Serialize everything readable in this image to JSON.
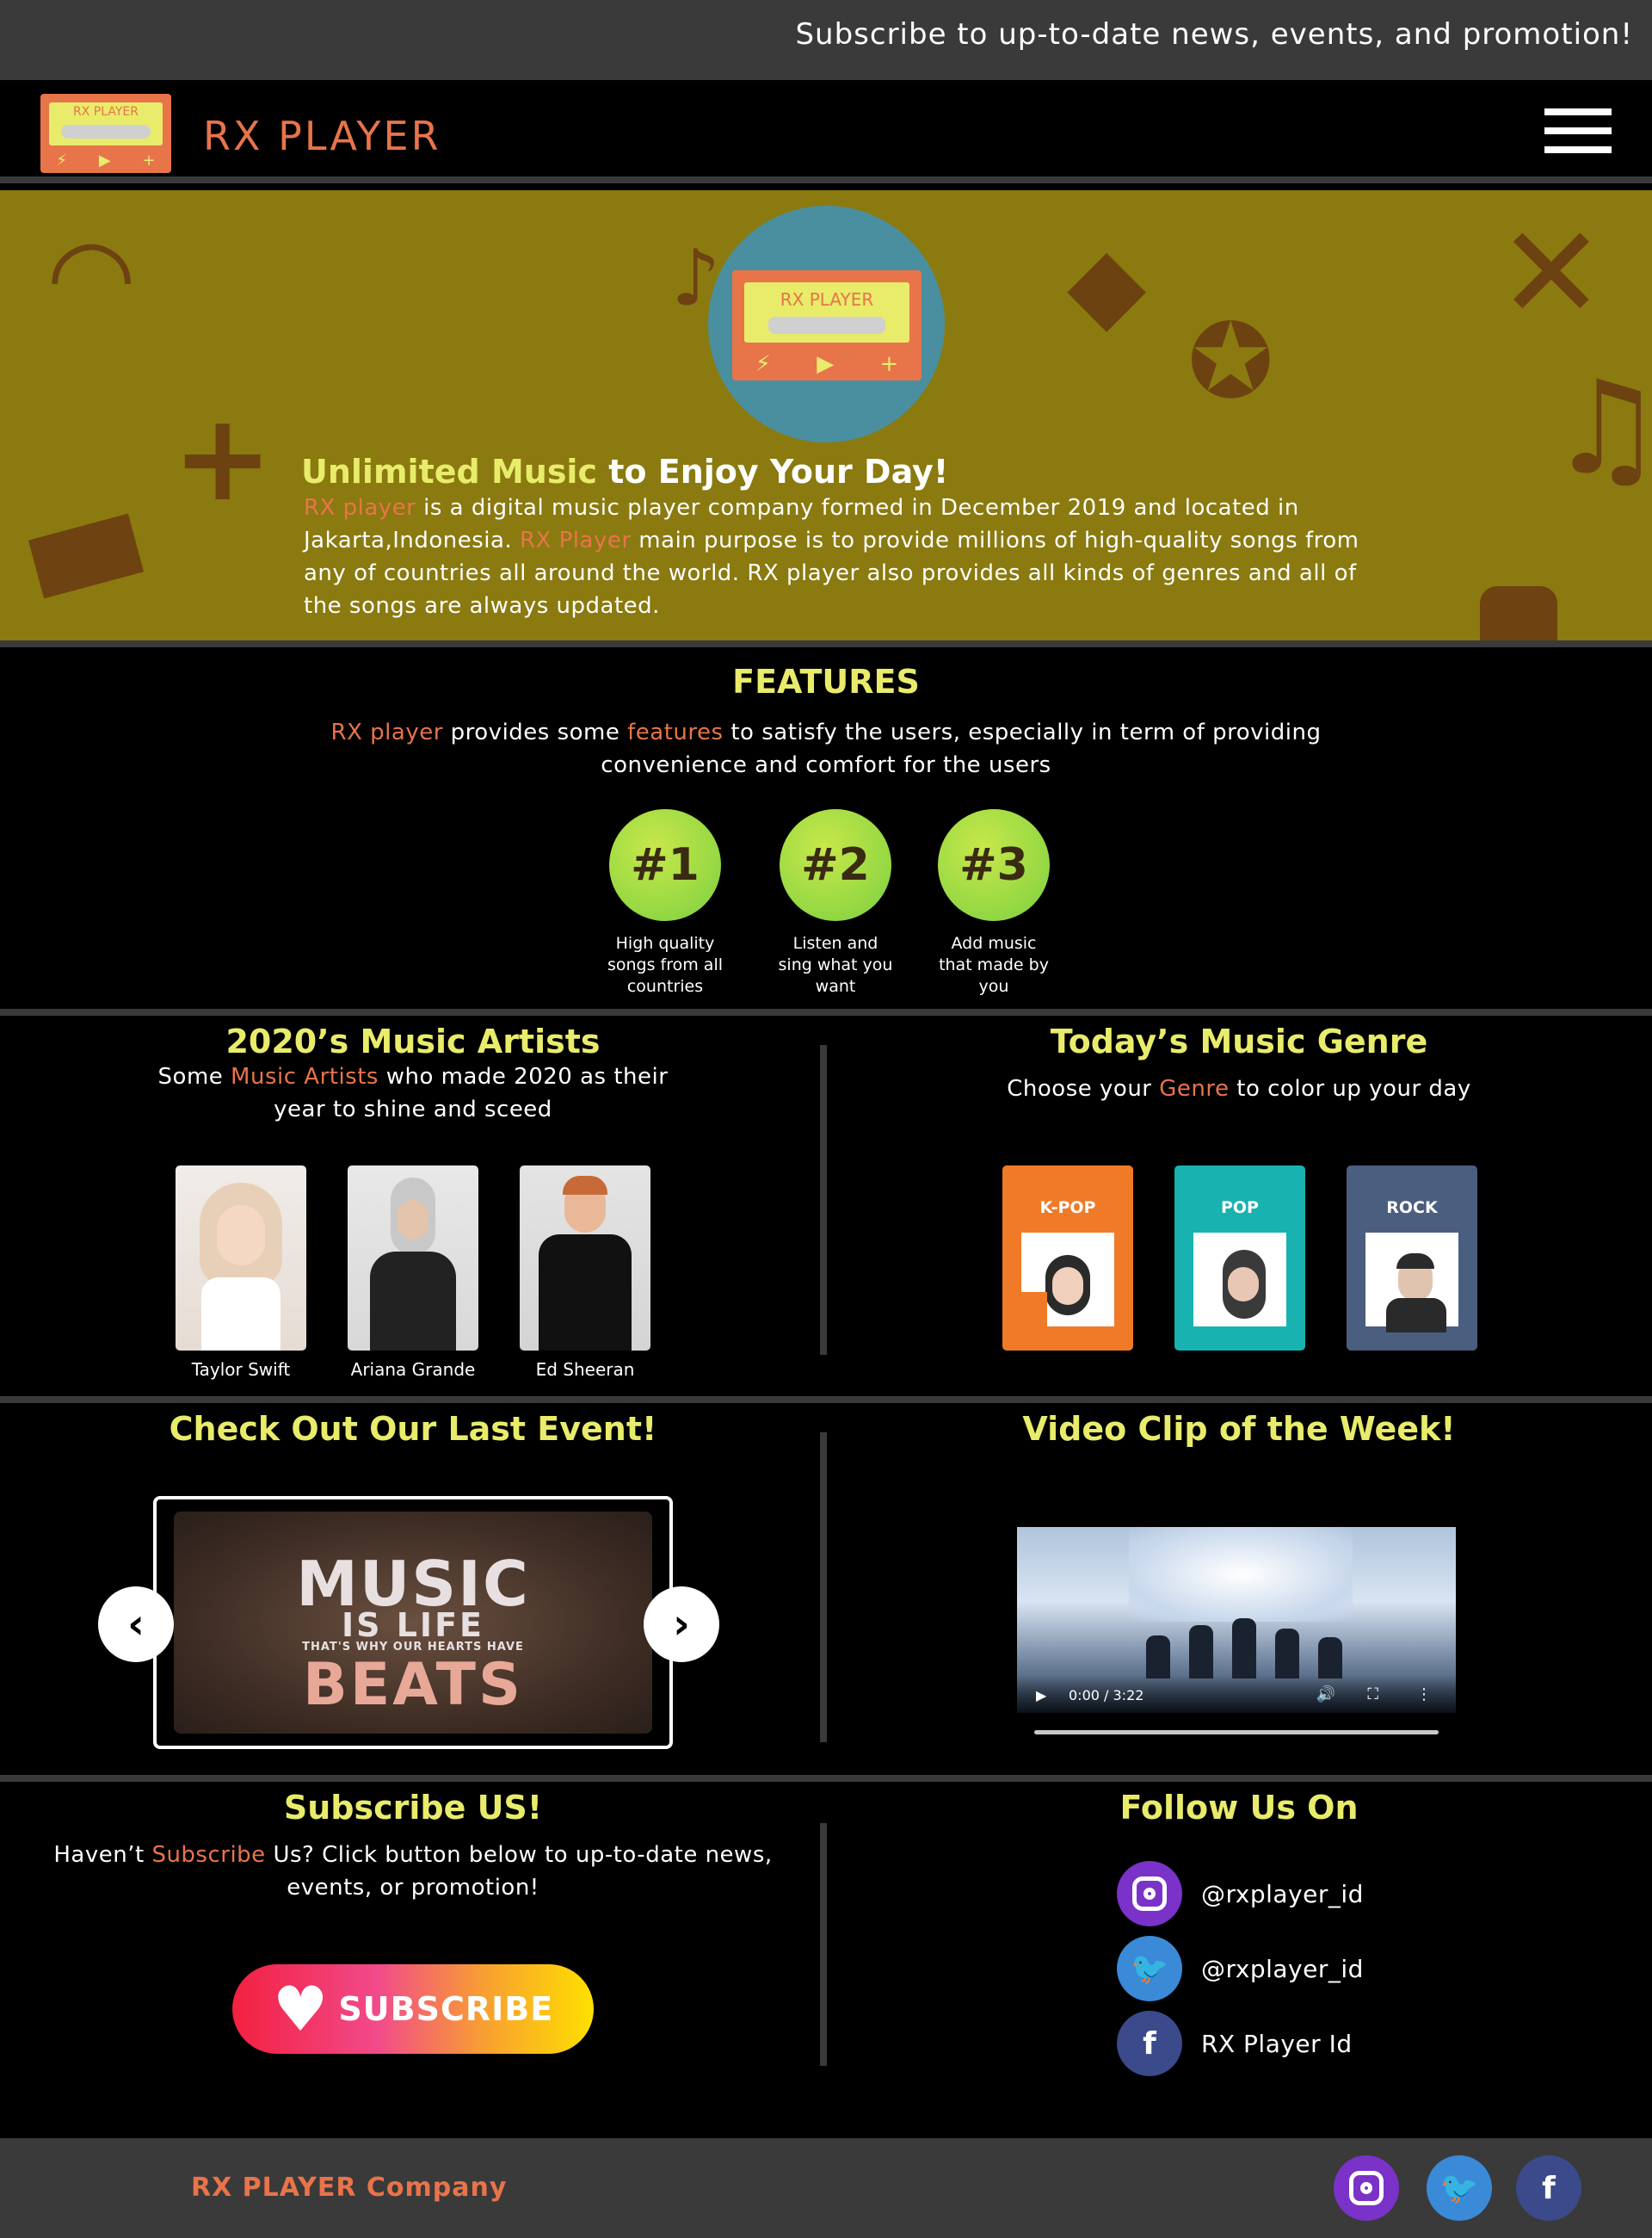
{
  "topbar": {
    "subscribe_text": "Subscribe to up-to-date news, events, and promotion!"
  },
  "header": {
    "logo_text": "RX PLAYER",
    "brand": "RX PLAYER",
    "menu_icon": "hamburger-menu-icon"
  },
  "hero": {
    "logo_text": "RX PLAYER",
    "title_highlight": "Unlimited Music",
    "title_rest": " to Enjoy Your Day!",
    "p1_highlight": "RX player",
    "p1_rest": " is a digital music player company formed in December 2019 and located in Jakarta,Indonesia. ",
    "p2_highlight": "RX Player",
    "p2_rest": " main purpose is to provide millions of high-quality songs from any of countries all around the world. RX player also provides all kinds of genres and all of the songs are always updated."
  },
  "features": {
    "title": "FEATURES",
    "desc_h1": "RX player",
    "desc_mid": " provides some ",
    "desc_h2": "features",
    "desc_rest": " to satisfy the users, especially in term of providing convenience and comfort for the users",
    "items": [
      {
        "num": "#1",
        "caption": "High quality songs from all countries"
      },
      {
        "num": "#2",
        "caption": "Listen and sing what you want"
      },
      {
        "num": "#3",
        "caption": "Add music that made by you"
      }
    ]
  },
  "artists": {
    "title": "2020’s Music Artists",
    "desc_pre": "Some ",
    "desc_highlight": "Music Artists",
    "desc_rest": " who made 2020 as their year to shine and sceed",
    "items": [
      {
        "name": "Taylor Swift"
      },
      {
        "name": "Ariana Grande"
      },
      {
        "name": "Ed Sheeran"
      }
    ]
  },
  "genres": {
    "title": "Today’s Music Genre",
    "desc_pre": "Choose your ",
    "desc_highlight": "Genre",
    "desc_rest": " to color up your day",
    "items": [
      {
        "label": "K-POP",
        "color": "#f07a28"
      },
      {
        "label": "POP",
        "color": "#18b2b0"
      },
      {
        "label": "ROCK",
        "color": "#4a5e80"
      }
    ]
  },
  "event": {
    "title": "Check Out Our Last Event!",
    "img_line1": "MUSIC",
    "img_line2": "IS LIFE",
    "img_line3": "THAT'S WHY OUR HEARTS HAVE",
    "img_line4": "BEATS",
    "prev_icon": "chevron-left-icon",
    "next_icon": "chevron-right-icon"
  },
  "video": {
    "title": "Video Clip of the Week!",
    "time": "0:00 / 3:22"
  },
  "subscribe": {
    "title": "Subscribe US!",
    "desc_pre": "Haven’t ",
    "desc_highlight": "Subscribe",
    "desc_rest": " Us? Click button below to up-to-date news, events, or promotion!",
    "button_label": "SUBSCRIBE"
  },
  "follow": {
    "title": "Follow Us On",
    "items": [
      {
        "icon": "instagram-icon",
        "handle": "@rxplayer_id"
      },
      {
        "icon": "twitter-icon",
        "handle": "@rxplayer_id"
      },
      {
        "icon": "facebook-icon",
        "handle": "RX Player Id"
      }
    ]
  },
  "footer": {
    "company": "RX PLAYER Company"
  },
  "colors": {
    "accent_orange": "#e8744a",
    "accent_yellow": "#e8ec6a",
    "hero_bg": "#8a7a10",
    "separator": "#3a3a3a"
  }
}
